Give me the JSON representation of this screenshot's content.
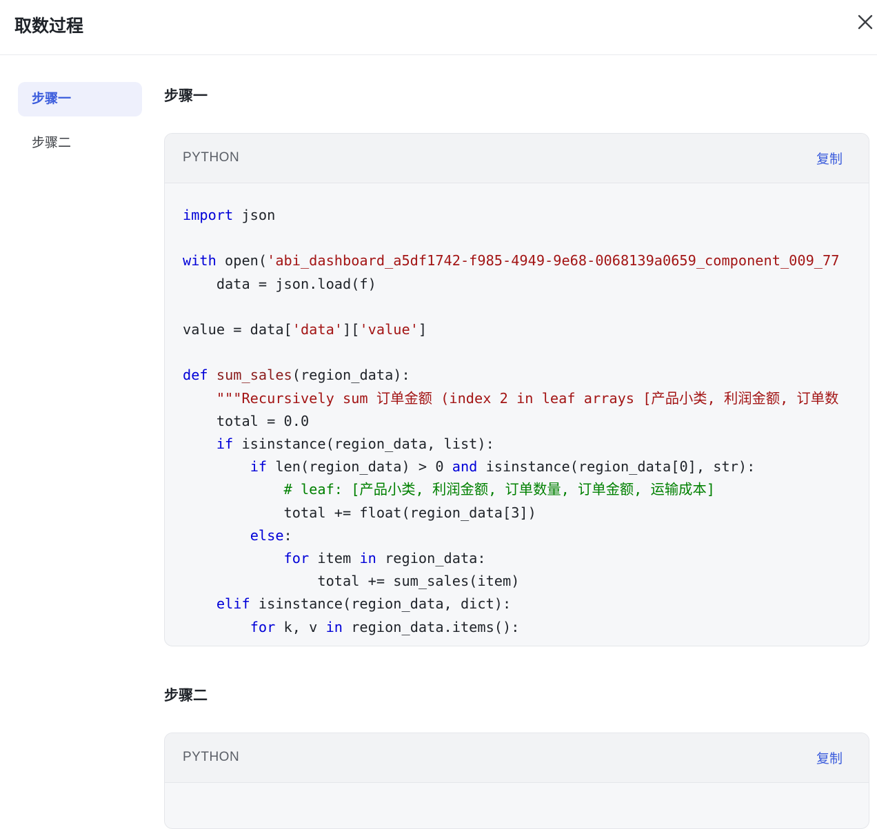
{
  "header": {
    "title": "取数过程"
  },
  "sidebar": {
    "items": [
      {
        "label": "步骤一",
        "active": true
      },
      {
        "label": "步骤二",
        "active": false
      }
    ]
  },
  "steps": [
    {
      "title": "步骤一",
      "language": "PYTHON",
      "copy_label": "复制",
      "code_lines": [
        [
          {
            "t": "import",
            "c": "k"
          },
          {
            "t": " json",
            "c": "p"
          }
        ],
        [],
        [
          {
            "t": "with",
            "c": "k"
          },
          {
            "t": " open(",
            "c": "p"
          },
          {
            "t": "'abi_dashboard_a5df1742-f985-4949-9e68-0068139a0659_component_009_77",
            "c": "s"
          }
        ],
        [
          {
            "t": "    data = json.load(f)",
            "c": "p"
          }
        ],
        [],
        [
          {
            "t": "value = data[",
            "c": "p"
          },
          {
            "t": "'data'",
            "c": "s"
          },
          {
            "t": "][",
            "c": "p"
          },
          {
            "t": "'value'",
            "c": "s"
          },
          {
            "t": "]",
            "c": "p"
          }
        ],
        [],
        [
          {
            "t": "def",
            "c": "k"
          },
          {
            "t": " ",
            "c": "p"
          },
          {
            "t": "sum_sales",
            "c": "f"
          },
          {
            "t": "(region_data):",
            "c": "p"
          }
        ],
        [
          {
            "t": "    ",
            "c": "p"
          },
          {
            "t": "\"\"\"Recursively sum 订单金额 (index 2 in leaf arrays [产品小类, 利润金额, 订单数",
            "c": "s"
          }
        ],
        [
          {
            "t": "    total = 0.0",
            "c": "p"
          }
        ],
        [
          {
            "t": "    ",
            "c": "p"
          },
          {
            "t": "if",
            "c": "k"
          },
          {
            "t": " isinstance(region_data, list):",
            "c": "p"
          }
        ],
        [
          {
            "t": "        ",
            "c": "p"
          },
          {
            "t": "if",
            "c": "k"
          },
          {
            "t": " len(region_data) > 0 ",
            "c": "p"
          },
          {
            "t": "and",
            "c": "k"
          },
          {
            "t": " isinstance(region_data[0], str):",
            "c": "p"
          }
        ],
        [
          {
            "t": "            ",
            "c": "p"
          },
          {
            "t": "# leaf: [产品小类, 利润金额, 订单数量, 订单金额, 运输成本]",
            "c": "c"
          }
        ],
        [
          {
            "t": "            total += float(region_data[3])",
            "c": "p"
          }
        ],
        [
          {
            "t": "        ",
            "c": "p"
          },
          {
            "t": "else",
            "c": "k"
          },
          {
            "t": ":",
            "c": "p"
          }
        ],
        [
          {
            "t": "            ",
            "c": "p"
          },
          {
            "t": "for",
            "c": "k"
          },
          {
            "t": " item ",
            "c": "p"
          },
          {
            "t": "in",
            "c": "k"
          },
          {
            "t": " region_data:",
            "c": "p"
          }
        ],
        [
          {
            "t": "                total += sum_sales(item)",
            "c": "p"
          }
        ],
        [
          {
            "t": "    ",
            "c": "p"
          },
          {
            "t": "elif",
            "c": "k"
          },
          {
            "t": " isinstance(region_data, dict):",
            "c": "p"
          }
        ],
        [
          {
            "t": "        ",
            "c": "p"
          },
          {
            "t": "for",
            "c": "k"
          },
          {
            "t": " k, v ",
            "c": "p"
          },
          {
            "t": "in",
            "c": "k"
          },
          {
            "t": " region_data.items():",
            "c": "p"
          }
        ]
      ]
    },
    {
      "title": "步骤二",
      "language": "PYTHON",
      "copy_label": "复制",
      "code_lines": []
    }
  ]
}
